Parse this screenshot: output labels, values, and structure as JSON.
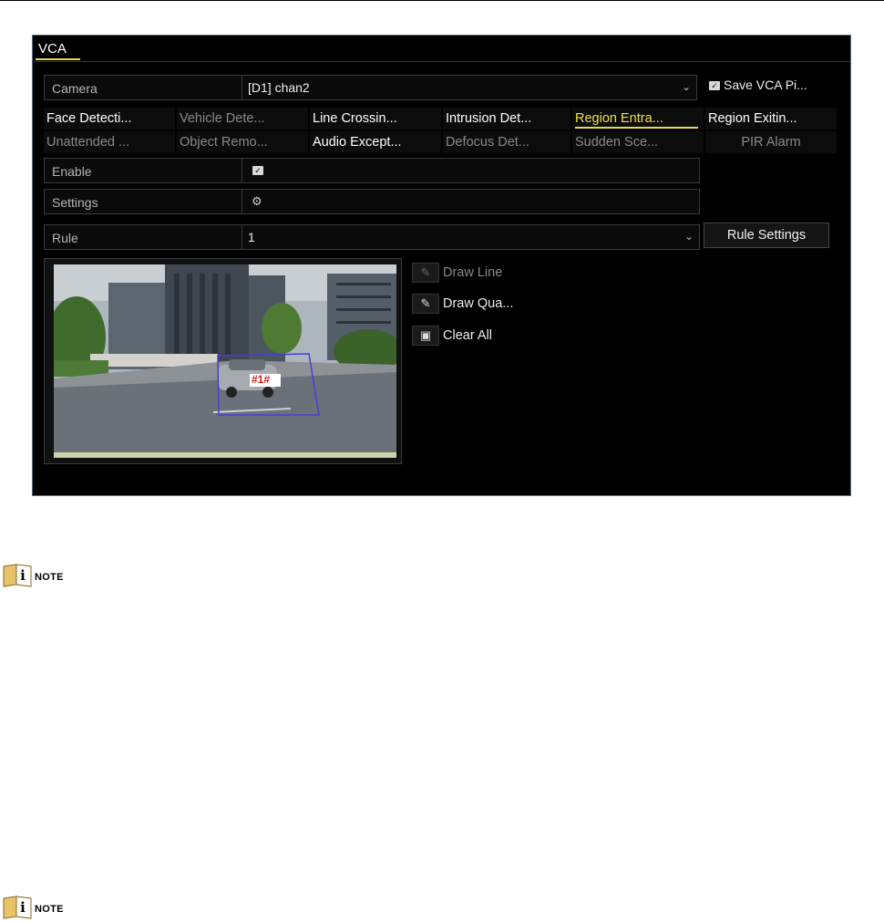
{
  "panel": {
    "title": "VCA",
    "camera": {
      "label": "Camera",
      "value": "[D1] chan2"
    },
    "save_pic": {
      "label": "Save VCA Pi..."
    },
    "tabs": [
      {
        "label": "Face Detecti...",
        "state": "on"
      },
      {
        "label": "Vehicle Dete...",
        "state": "off"
      },
      {
        "label": "Line Crossin...",
        "state": "on"
      },
      {
        "label": "Intrusion Det...",
        "state": "on"
      },
      {
        "label": "Region Entra...",
        "state": "selected"
      },
      {
        "label": "Region Exitin...",
        "state": "on"
      },
      {
        "label": "Unattended ...",
        "state": "off"
      },
      {
        "label": "Object Remo...",
        "state": "off"
      },
      {
        "label": "Audio Except...",
        "state": "on"
      },
      {
        "label": "Defocus Det...",
        "state": "off"
      },
      {
        "label": "Sudden Sce...",
        "state": "off"
      },
      {
        "label": "PIR Alarm",
        "state": "off"
      }
    ],
    "enable": {
      "label": "Enable"
    },
    "settings": {
      "label": "Settings"
    },
    "rule": {
      "label": "Rule",
      "value": "1"
    },
    "rule_settings": "Rule Settings",
    "tools": {
      "draw_line": "Draw Line",
      "draw_quad": "Draw Qua...",
      "clear_all": "Clear All"
    },
    "region_tag": "#1#"
  },
  "notes": [
    "NOTE",
    "NOTE"
  ],
  "colors": {
    "selected_tab": "#f0e04a",
    "region": "#4a3cd8",
    "tag": "#d81a1a"
  }
}
